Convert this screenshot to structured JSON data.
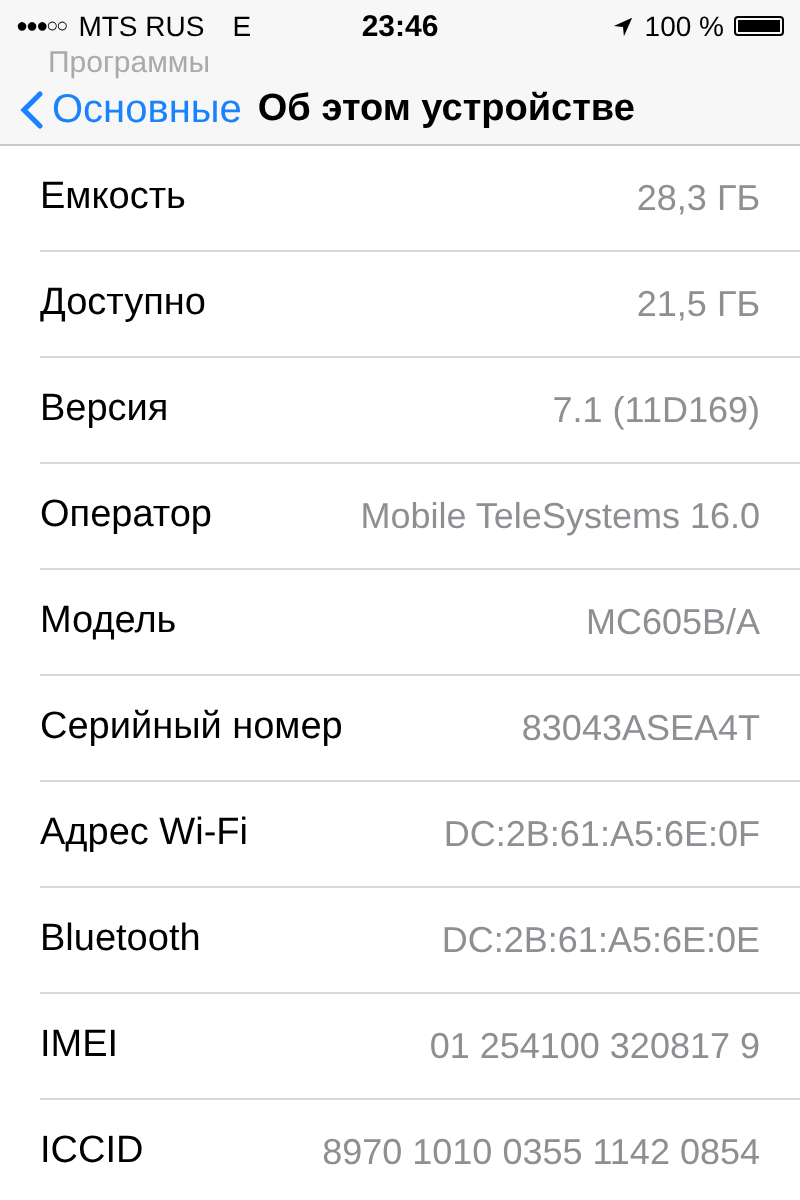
{
  "status_bar": {
    "signal_dots": "●●●○○",
    "carrier": "MTS RUS",
    "network": "E",
    "time": "23:46",
    "battery": "100 %"
  },
  "nav_bar": {
    "previous_title": "Программы",
    "back": "Основные",
    "title": "Об этом устройстве"
  },
  "rows": [
    {
      "label": "Емкость",
      "value": "28,3 ГБ"
    },
    {
      "label": "Доступно",
      "value": "21,5 ГБ"
    },
    {
      "label": "Версия",
      "value": "7.1 (11D169)"
    },
    {
      "label": "Оператор",
      "value": "Mobile TeleSystems 16.0"
    },
    {
      "label": "Модель",
      "value": "MC605B/A"
    },
    {
      "label": "Серийный номер",
      "value": "83043ASEA4T"
    },
    {
      "label": "Адрес Wi-Fi",
      "value": "DC:2B:61:A5:6E:0F"
    },
    {
      "label": "Bluetooth",
      "value": "DC:2B:61:A5:6E:0E"
    },
    {
      "label": "IMEI",
      "value": "01 254100 320817 9"
    },
    {
      "label": "ICCID",
      "value": "8970 1010 0355 1142 0854"
    }
  ]
}
